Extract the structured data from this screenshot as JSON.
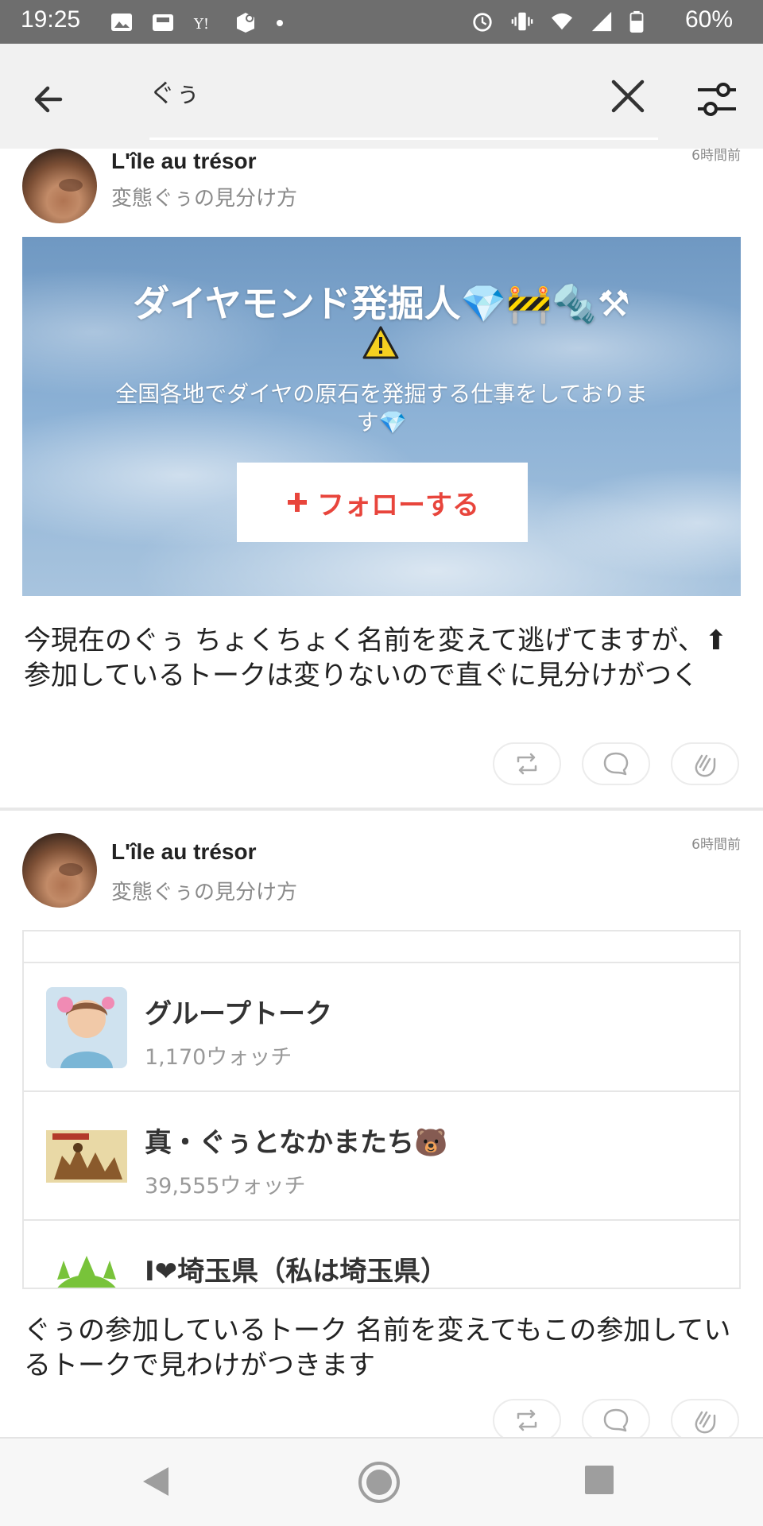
{
  "status_bar": {
    "time": "19:25",
    "battery": "60%",
    "left_icons": [
      "image-icon",
      "inbox-icon",
      "yahoo-icon",
      "messenger-icon",
      "dot-icon"
    ],
    "right_icons": [
      "alarm-icon",
      "vibrate-icon",
      "wifi-icon",
      "signal-icon",
      "battery-icon"
    ]
  },
  "search": {
    "query": "ぐぅ",
    "back_icon": "arrow-left-icon",
    "clear_icon": "close-icon",
    "filter_icon": "filter-sliders-icon"
  },
  "posts": [
    {
      "author": "L'île au trésor",
      "subtitle": "変態ぐぅの見分け方",
      "time": "6時間前",
      "banner": {
        "title": "ダイヤモンド発掘人💎🚧🔩⚒",
        "warning_icon": "warning-icon",
        "description": "全国各地でダイヤの原石を発掘する仕事をしております💎",
        "follow_label": "フォローする"
      },
      "text": "今現在のぐぅ ちょくちょく名前を変えて逃げてますが、⬆参加しているトークは変りないので直ぐに見分けがつく"
    },
    {
      "author": "L'île au trésor",
      "subtitle": "変態ぐぅの見分け方",
      "time": "6時間前",
      "talks": [
        {
          "title": "グループトーク",
          "watch": "1,170ウォッチ"
        },
        {
          "title": "真・ぐぅとなかまたち🐻",
          "watch": "39,555ウォッチ"
        },
        {
          "title": "I❤埼玉県（私は埼玉県）",
          "watch": ""
        }
      ],
      "text": "ぐぅの参加しているトーク 名前を変えてもこの参加しているトークで見わけがつきます"
    }
  ],
  "actions": [
    "repost-icon",
    "comment-icon",
    "clap-icon"
  ],
  "nav_bar": [
    "back-triangle-icon",
    "home-circle-icon",
    "recents-square-icon"
  ],
  "colors": {
    "status_bar": "#6e6e6e",
    "header": "#f1f1f1",
    "follow_text": "#e8453c"
  }
}
